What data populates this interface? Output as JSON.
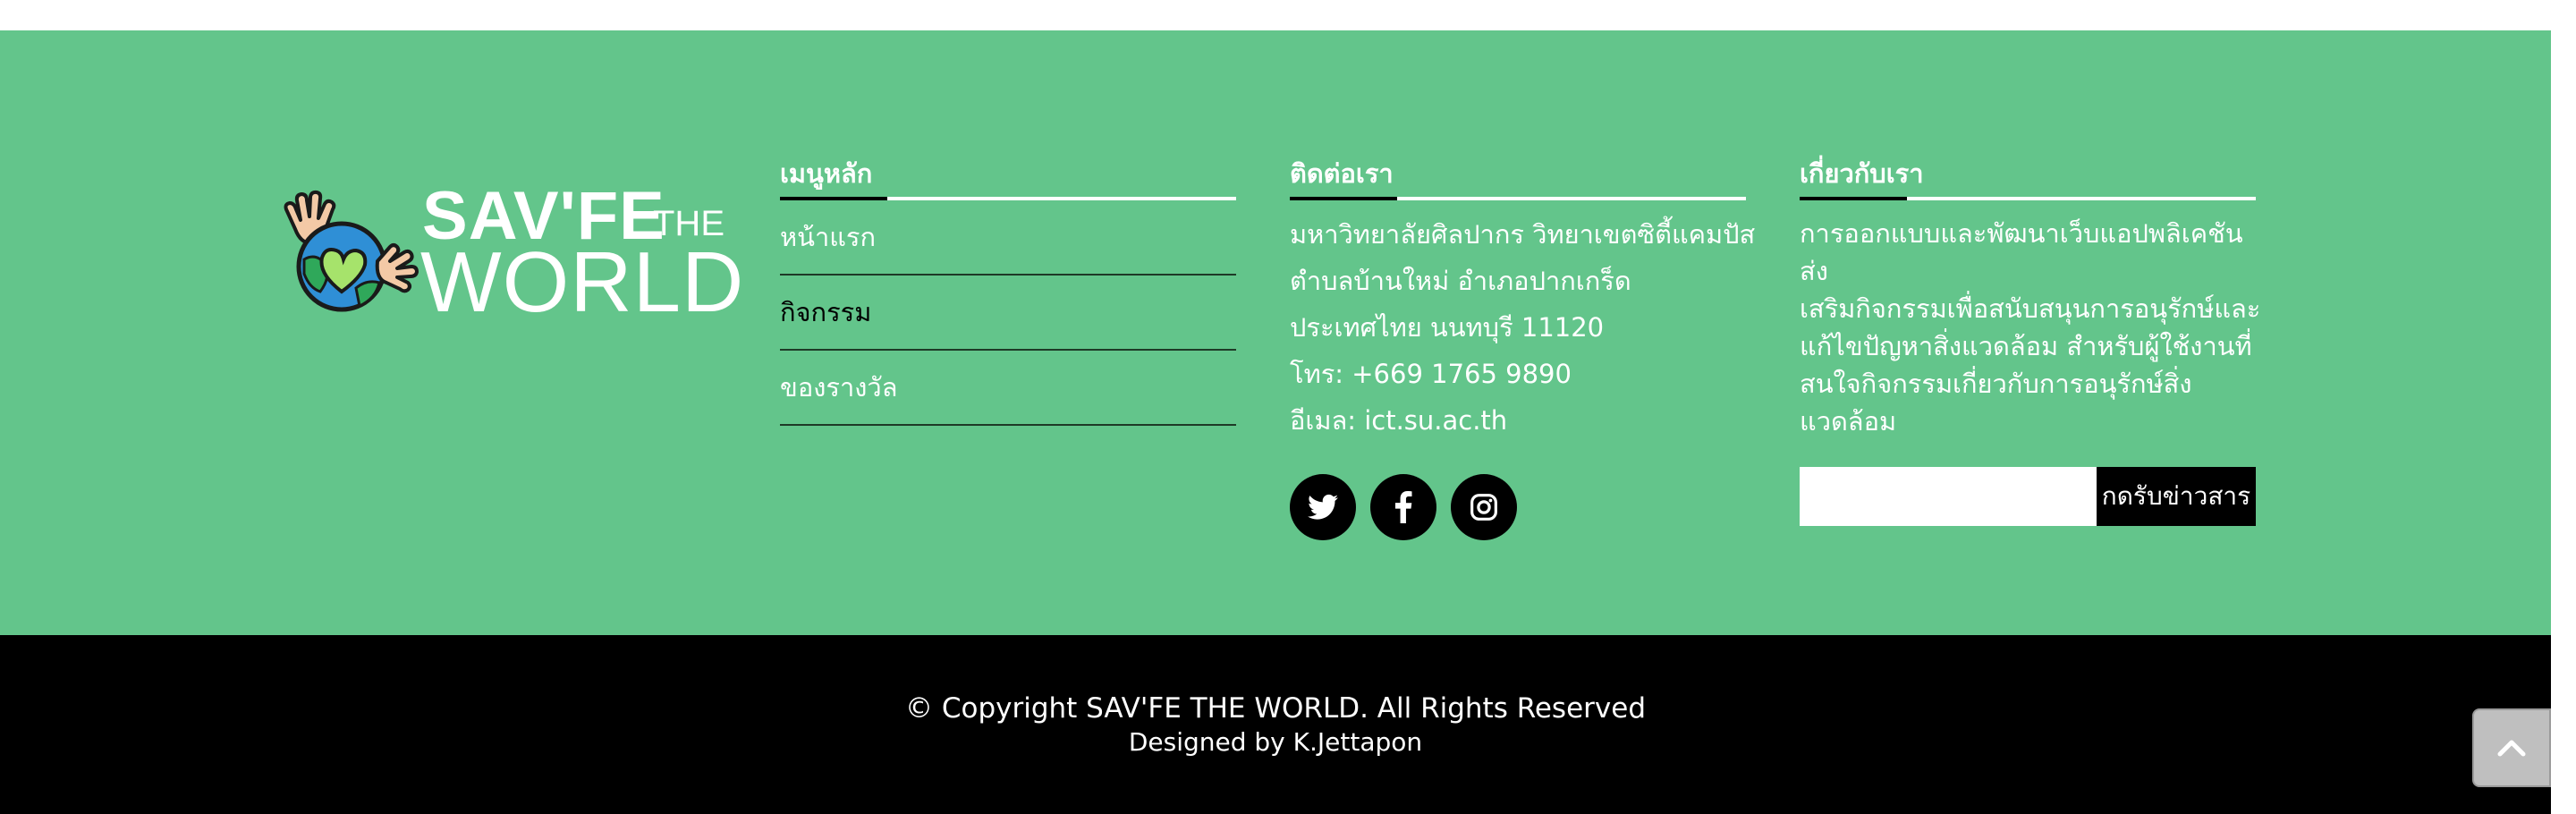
{
  "brand": {
    "title": "SAV'FE",
    "the": "THE",
    "world": "WORLD"
  },
  "menu": {
    "title": "เมนูหลัก",
    "items": [
      {
        "label": "หน้าแรก",
        "active": false
      },
      {
        "label": "กิจกรรม",
        "active": true
      },
      {
        "label": "ของรางวัล",
        "active": false
      }
    ]
  },
  "contact": {
    "title": "ติดต่อเรา",
    "address1": "มหาวิทยาลัยศิลปากร วิทยาเขตซิตี้แคมปัส",
    "address2": "ตำบลบ้านใหม่ อำเภอปากเกร็ด",
    "address3": "ประเทศไทย นนทบุรี 11120",
    "phone": "โทร: +669 1765 9890",
    "email": "อีเมล: ict.su.ac.th",
    "social": [
      "twitter-icon",
      "facebook-icon",
      "instagram-icon"
    ]
  },
  "about": {
    "title": "เกี่ยวกับเรา",
    "line1": "การออกแบบและพัฒนาเว็บแอปพลิเคชันส่ง",
    "line2": "เสริมกิจกรรมเพื่อสนับสนุนการอนุรักษ์และ",
    "line3": "แก้ไขปัญหาสิ่งแวดล้อม สำหรับผู้ใช้งานที่",
    "line4": "สนใจกิจกรรมเกี่ยวกับการอนุรักษ์สิ่ง",
    "line5": "แวดล้อม",
    "newsletter_placeholder": "",
    "newsletter_button": "กดรับข่าวสาร"
  },
  "bottom": {
    "copyright": "© Copyright SAV'FE THE WORLD. All Rights Reserved",
    "designed": "Designed by K.Jettapon"
  },
  "colors": {
    "footer_green": "#63c58b",
    "bottom_bar": "#000000",
    "accent_dark": "#000000"
  }
}
